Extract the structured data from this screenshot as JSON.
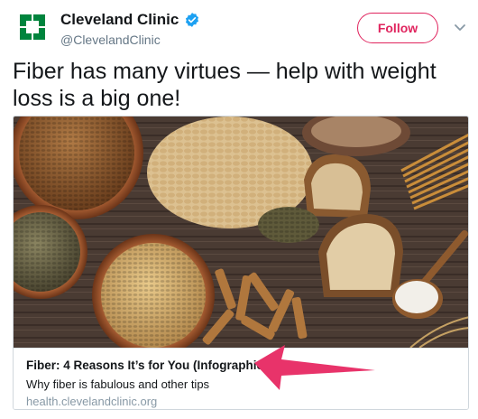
{
  "account": {
    "name": "Cleveland Clinic",
    "handle": "@ClevelandClinic",
    "verified_icon": "verified-badge-icon",
    "brand_color": "#00843d"
  },
  "follow_button": {
    "label": "Follow",
    "color": "#e0245e"
  },
  "menu_icon": "chevron-down-icon",
  "tweet": {
    "text": "Fiber has many virtues — help with weight loss is a big one!"
  },
  "card": {
    "image": "grains-and-bread-photo",
    "title": "Fiber: 4 Reasons It’s for You (Infographic)",
    "description": "Why fiber is fabulous and other tips",
    "domain": "health.clevelandclinic.org"
  },
  "annotation": {
    "icon": "arrow-icon",
    "color": "#e8336a"
  }
}
